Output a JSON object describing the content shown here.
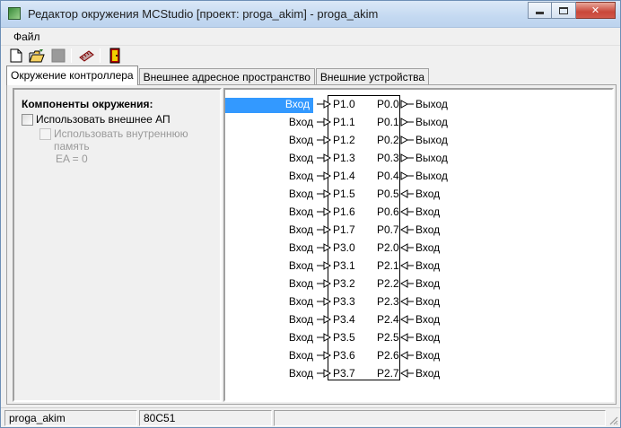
{
  "window": {
    "title": "Редактор окружения MCStudio [проект: proga_akim] - proga_akim"
  },
  "menu": {
    "file": "Файл"
  },
  "toolbar": {
    "buttons": [
      "new-document-icon",
      "open-folder-icon",
      "save-disabled-icon",
      "chip-icon",
      "exit-icon"
    ]
  },
  "tabs": [
    {
      "label": "Окружение контроллера",
      "active": true
    },
    {
      "label": "Внешнее адресное пространство",
      "active": false
    },
    {
      "label": "Внешние устройства",
      "active": false
    }
  ],
  "components": {
    "heading": "Компоненты окружения:",
    "use_external_ap": "Использовать внешнее АП",
    "use_internal_memory": "Использовать внутреннюю память",
    "ea_value": "EA = 0"
  },
  "pins_left": [
    {
      "dir": "Вход",
      "name": "P1.0"
    },
    {
      "dir": "Вход",
      "name": "P1.1"
    },
    {
      "dir": "Вход",
      "name": "P1.2"
    },
    {
      "dir": "Вход",
      "name": "P1.3"
    },
    {
      "dir": "Вход",
      "name": "P1.4"
    },
    {
      "dir": "Вход",
      "name": "P1.5"
    },
    {
      "dir": "Вход",
      "name": "P1.6"
    },
    {
      "dir": "Вход",
      "name": "P1.7"
    },
    {
      "dir": "Вход",
      "name": "P3.0"
    },
    {
      "dir": "Вход",
      "name": "P3.1"
    },
    {
      "dir": "Вход",
      "name": "P3.2"
    },
    {
      "dir": "Вход",
      "name": "P3.3"
    },
    {
      "dir": "Вход",
      "name": "P3.4"
    },
    {
      "dir": "Вход",
      "name": "P3.5"
    },
    {
      "dir": "Вход",
      "name": "P3.6"
    },
    {
      "dir": "Вход",
      "name": "P3.7"
    }
  ],
  "pins_right": [
    {
      "name": "P0.0",
      "dir": "Выход"
    },
    {
      "name": "P0.1",
      "dir": "Выход"
    },
    {
      "name": "P0.2",
      "dir": "Выход"
    },
    {
      "name": "P0.3",
      "dir": "Выход"
    },
    {
      "name": "P0.4",
      "dir": "Выход"
    },
    {
      "name": "P0.5",
      "dir": "Вход"
    },
    {
      "name": "P0.6",
      "dir": "Вход"
    },
    {
      "name": "P0.7",
      "dir": "Вход"
    },
    {
      "name": "P2.0",
      "dir": "Вход"
    },
    {
      "name": "P2.1",
      "dir": "Вход"
    },
    {
      "name": "P2.2",
      "dir": "Вход"
    },
    {
      "name": "P2.3",
      "dir": "Вход"
    },
    {
      "name": "P2.4",
      "dir": "Вход"
    },
    {
      "name": "P2.5",
      "dir": "Вход"
    },
    {
      "name": "P2.6",
      "dir": "Вход"
    },
    {
      "name": "P2.7",
      "dir": "Вход"
    }
  ],
  "status": {
    "project": "proga_akim",
    "controller": "80C51"
  },
  "colors": {
    "selection": "#3399ff"
  }
}
